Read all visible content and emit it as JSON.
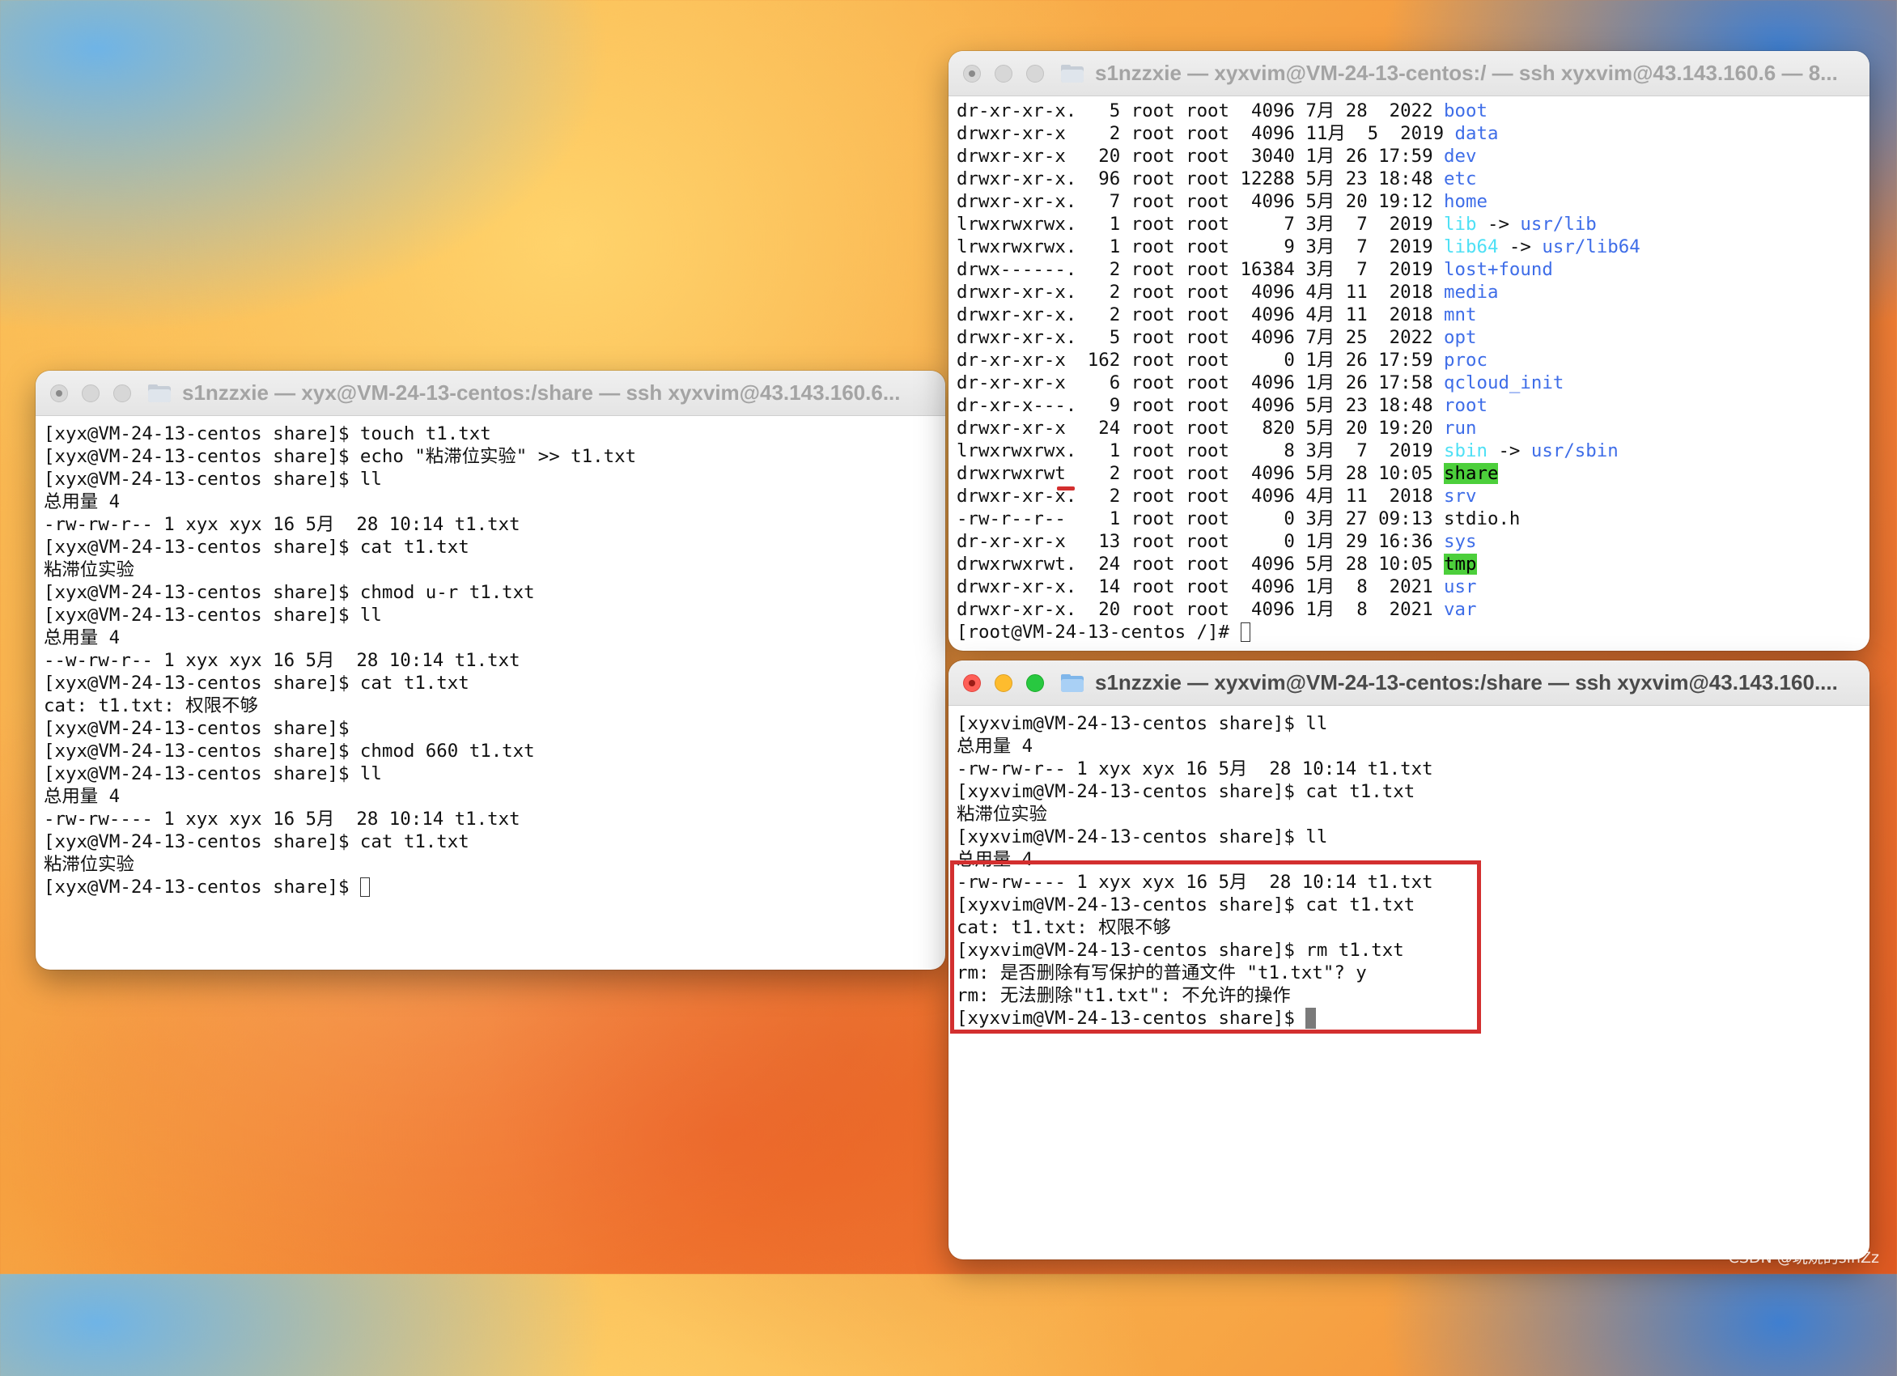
{
  "windows": {
    "left": {
      "title": "s1nzzxie — xyx@VM-24-13-centos:/share — ssh xyxvim@43.143.160.6...",
      "lines": [
        "[xyx@VM-24-13-centos share]$ touch t1.txt",
        "[xyx@VM-24-13-centos share]$ echo \"粘滞位实验\" >> t1.txt",
        "[xyx@VM-24-13-centos share]$ ll",
        "总用量 4",
        "-rw-rw-r-- 1 xyx xyx 16 5月  28 10:14 t1.txt",
        "[xyx@VM-24-13-centos share]$ cat t1.txt",
        "粘滞位实验",
        "[xyx@VM-24-13-centos share]$ chmod u-r t1.txt",
        "[xyx@VM-24-13-centos share]$ ll",
        "总用量 4",
        "--w-rw-r-- 1 xyx xyx 16 5月  28 10:14 t1.txt",
        "[xyx@VM-24-13-centos share]$ cat t1.txt",
        "cat: t1.txt: 权限不够",
        "[xyx@VM-24-13-centos share]$",
        "[xyx@VM-24-13-centos share]$ chmod 660 t1.txt",
        "[xyx@VM-24-13-centos share]$ ll",
        "总用量 4",
        "-rw-rw---- 1 xyx xyx 16 5月  28 10:14 t1.txt",
        "[xyx@VM-24-13-centos share]$ cat t1.txt",
        "粘滞位实验"
      ],
      "prompt": "[xyx@VM-24-13-centos share]$ "
    },
    "top_right": {
      "title": "s1nzzxie — xyxvim@VM-24-13-centos:/ — ssh xyxvim@43.143.160.6 — 8...",
      "entries": [
        {
          "perm": "dr-xr-xr-x.",
          "links": "5",
          "user": "root",
          "group": "root",
          "size": "4096",
          "month": "7月",
          "day": "28",
          "time": "2022",
          "name": "boot",
          "color": "blue"
        },
        {
          "perm": "drwxr-xr-x",
          "links": "2",
          "user": "root",
          "group": "root",
          "size": "4096",
          "month": "11月",
          "day": "5",
          "time": "2019",
          "name": "data",
          "color": "blue"
        },
        {
          "perm": "drwxr-xr-x",
          "links": "20",
          "user": "root",
          "group": "root",
          "size": "3040",
          "month": "1月",
          "day": "26",
          "time": "17:59",
          "name": "dev",
          "color": "blue"
        },
        {
          "perm": "drwxr-xr-x.",
          "links": "96",
          "user": "root",
          "group": "root",
          "size": "12288",
          "month": "5月",
          "day": "23",
          "time": "18:48",
          "name": "etc",
          "color": "blue"
        },
        {
          "perm": "drwxr-xr-x.",
          "links": "7",
          "user": "root",
          "group": "root",
          "size": "4096",
          "month": "5月",
          "day": "20",
          "time": "19:12",
          "name": "home",
          "color": "blue"
        },
        {
          "perm": "lrwxrwxrwx.",
          "links": "1",
          "user": "root",
          "group": "root",
          "size": "7",
          "month": "3月",
          "day": "7",
          "time": "2019",
          "name": "lib",
          "color": "cyan",
          "arrow": " -> ",
          "target": "usr/lib"
        },
        {
          "perm": "lrwxrwxrwx.",
          "links": "1",
          "user": "root",
          "group": "root",
          "size": "9",
          "month": "3月",
          "day": "7",
          "time": "2019",
          "name": "lib64",
          "color": "cyan",
          "arrow": " -> ",
          "target": "usr/lib64"
        },
        {
          "perm": "drwx------.",
          "links": "2",
          "user": "root",
          "group": "root",
          "size": "16384",
          "month": "3月",
          "day": "7",
          "time": "2019",
          "name": "lost+found",
          "color": "blue"
        },
        {
          "perm": "drwxr-xr-x.",
          "links": "2",
          "user": "root",
          "group": "root",
          "size": "4096",
          "month": "4月",
          "day": "11",
          "time": "2018",
          "name": "media",
          "color": "blue"
        },
        {
          "perm": "drwxr-xr-x.",
          "links": "2",
          "user": "root",
          "group": "root",
          "size": "4096",
          "month": "4月",
          "day": "11",
          "time": "2018",
          "name": "mnt",
          "color": "blue"
        },
        {
          "perm": "drwxr-xr-x.",
          "links": "5",
          "user": "root",
          "group": "root",
          "size": "4096",
          "month": "7月",
          "day": "25",
          "time": "2022",
          "name": "opt",
          "color": "blue"
        },
        {
          "perm": "dr-xr-xr-x",
          "links": "162",
          "user": "root",
          "group": "root",
          "size": "0",
          "month": "1月",
          "day": "26",
          "time": "17:59",
          "name": "proc",
          "color": "blue"
        },
        {
          "perm": "dr-xr-xr-x",
          "links": "6",
          "user": "root",
          "group": "root",
          "size": "4096",
          "month": "1月",
          "day": "26",
          "time": "17:58",
          "name": "qcloud_init",
          "color": "blue"
        },
        {
          "perm": "dr-xr-x---.",
          "links": "9",
          "user": "root",
          "group": "root",
          "size": "4096",
          "month": "5月",
          "day": "23",
          "time": "18:48",
          "name": "root",
          "color": "blue"
        },
        {
          "perm": "drwxr-xr-x",
          "links": "24",
          "user": "root",
          "group": "root",
          "size": "820",
          "month": "5月",
          "day": "20",
          "time": "19:20",
          "name": "run",
          "color": "blue"
        },
        {
          "perm": "lrwxrwxrwx.",
          "links": "1",
          "user": "root",
          "group": "root",
          "size": "8",
          "month": "3月",
          "day": "7",
          "time": "2019",
          "name": "sbin",
          "color": "cyan",
          "arrow": " -> ",
          "target": "usr/sbin"
        },
        {
          "perm": "drwxrwxrwt",
          "links": "2",
          "user": "root",
          "group": "root",
          "size": "4096",
          "month": "5月",
          "day": "28",
          "time": "10:05",
          "name": "share",
          "color": "highlight"
        },
        {
          "perm": "drwxr-xr-x.",
          "links": "2",
          "user": "root",
          "group": "root",
          "size": "4096",
          "month": "4月",
          "day": "11",
          "time": "2018",
          "name": "srv",
          "color": "blue"
        },
        {
          "perm": "-rw-r--r--",
          "links": "1",
          "user": "root",
          "group": "root",
          "size": "0",
          "month": "3月",
          "day": "27",
          "time": "09:13",
          "name": "stdio.h",
          "color": "plain"
        },
        {
          "perm": "dr-xr-xr-x",
          "links": "13",
          "user": "root",
          "group": "root",
          "size": "0",
          "month": "1月",
          "day": "29",
          "time": "16:36",
          "name": "sys",
          "color": "blue"
        },
        {
          "perm": "drwxrwxrwt.",
          "links": "24",
          "user": "root",
          "group": "root",
          "size": "4096",
          "month": "5月",
          "day": "28",
          "time": "10:05",
          "name": "tmp",
          "color": "highlight"
        },
        {
          "perm": "drwxr-xr-x.",
          "links": "14",
          "user": "root",
          "group": "root",
          "size": "4096",
          "month": "1月",
          "day": "8",
          "time": "2021",
          "name": "usr",
          "color": "blue"
        },
        {
          "perm": "drwxr-xr-x.",
          "links": "20",
          "user": "root",
          "group": "root",
          "size": "4096",
          "month": "1月",
          "day": "8",
          "time": "2021",
          "name": "var",
          "color": "blue"
        }
      ],
      "prompt": "[root@VM-24-13-centos /]# "
    },
    "bottom_right": {
      "title": "s1nzzxie — xyxvim@VM-24-13-centos:/share — ssh xyxvim@43.143.160....",
      "lines": [
        "[xyxvim@VM-24-13-centos share]$ ll",
        "总用量 4",
        "-rw-rw-r-- 1 xyx xyx 16 5月  28 10:14 t1.txt",
        "[xyxvim@VM-24-13-centos share]$ cat t1.txt",
        "粘滞位实验",
        "[xyxvim@VM-24-13-centos share]$ ll",
        "总用量 4",
        "-rw-rw---- 1 xyx xyx 16 5月  28 10:14 t1.txt",
        "[xyxvim@VM-24-13-centos share]$ cat t1.txt",
        "cat: t1.txt: 权限不够",
        "[xyxvim@VM-24-13-centos share]$ rm t1.txt",
        "rm: 是否删除有写保护的普通文件 \"t1.txt\"? y",
        "rm: 无法删除\"t1.txt\": 不允许的操作"
      ],
      "prompt": "[xyxvim@VM-24-13-centos share]$ "
    }
  },
  "watermark": "CSDN @玩烧的sinZz",
  "colors": {
    "dir": "#3e6de8",
    "link": "#4ee0f5",
    "sticky_bg": "#4ccf3b",
    "annotation": "#d32f2f"
  }
}
